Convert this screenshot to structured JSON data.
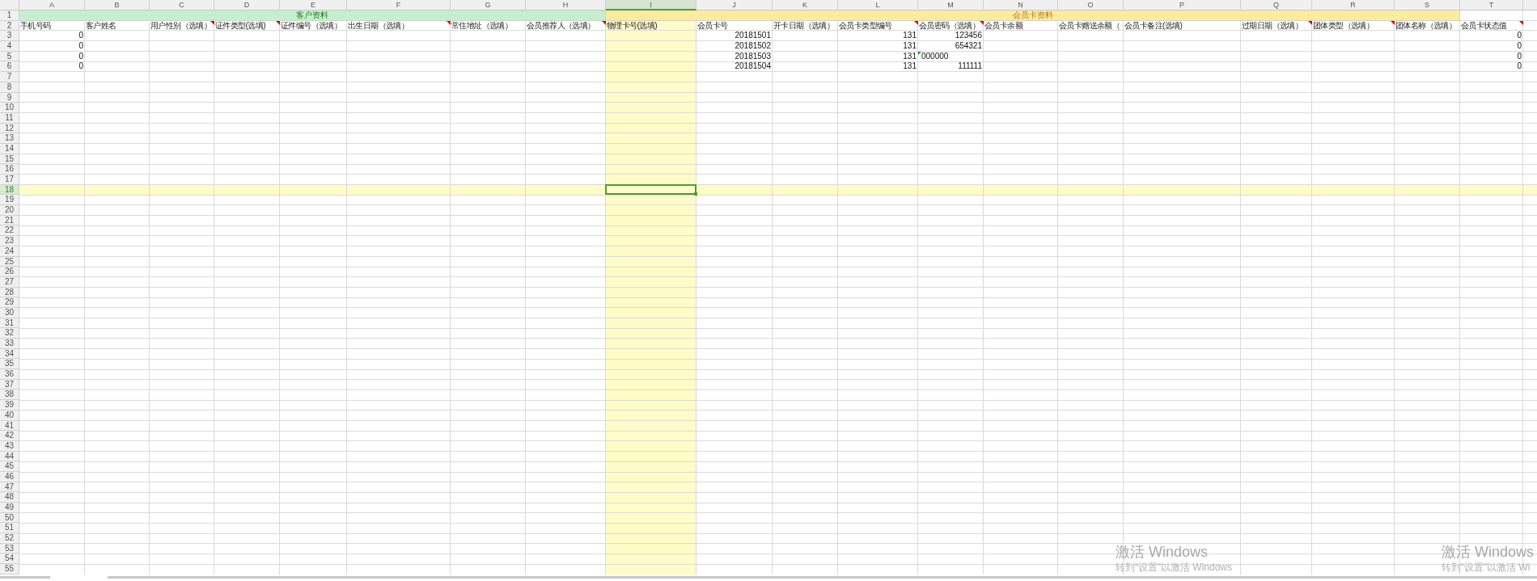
{
  "columns": [
    {
      "label": "A",
      "selected": false
    },
    {
      "label": "B",
      "selected": false
    },
    {
      "label": "C",
      "selected": false
    },
    {
      "label": "D",
      "selected": false
    },
    {
      "label": "E",
      "selected": false
    },
    {
      "label": "F",
      "selected": false
    },
    {
      "label": "G",
      "selected": false
    },
    {
      "label": "H",
      "selected": false
    },
    {
      "label": "I",
      "selected": true
    },
    {
      "label": "J",
      "selected": false
    },
    {
      "label": "K",
      "selected": false
    },
    {
      "label": "L",
      "selected": false
    },
    {
      "label": "M",
      "selected": false
    },
    {
      "label": "N",
      "selected": false
    },
    {
      "label": "O",
      "selected": false
    },
    {
      "label": "P",
      "selected": false
    },
    {
      "label": "Q",
      "selected": false
    },
    {
      "label": "R",
      "selected": false
    },
    {
      "label": "S",
      "selected": false
    },
    {
      "label": "T",
      "selected": false
    }
  ],
  "groups": [
    {
      "label": "客户资料",
      "kind": "customer",
      "color": "#c6efce"
    },
    {
      "label": "会员卡资料",
      "kind": "card",
      "color": "#ffeb9c"
    }
  ],
  "fields": [
    {
      "label": "手机号码",
      "comment": false
    },
    {
      "label": "客户姓名",
      "comment": false
    },
    {
      "label": "用户性别（选填）",
      "comment": true
    },
    {
      "label": "证件类型(选填)",
      "comment": true
    },
    {
      "label": "证件编号（选填）",
      "comment": false
    },
    {
      "label": "出生日期（选填）",
      "comment": true
    },
    {
      "label": "常住地址（选填）",
      "comment": false
    },
    {
      "label": "会员推荐人（选填）",
      "comment": true
    },
    {
      "label": "物理卡号(选填)",
      "comment": false
    },
    {
      "label": "会员卡号",
      "comment": false
    },
    {
      "label": "开卡日期（选填）",
      "comment": false
    },
    {
      "label": "会员卡类型编号",
      "comment": true
    },
    {
      "label": "会员密码（选填）",
      "comment": true
    },
    {
      "label": "会员卡余额",
      "comment": false
    },
    {
      "label": "会员卡赠送余额（",
      "comment": false
    },
    {
      "label": "会员卡备注(选填)",
      "comment": false
    },
    {
      "label": "过期日期（选填）",
      "comment": true
    },
    {
      "label": "团体类型（选填）",
      "comment": true
    },
    {
      "label": "团体名称（选填）",
      "comment": false
    },
    {
      "label": "会员卡状态值",
      "comment": true
    }
  ],
  "rows": [
    {
      "label": "1",
      "selected": false
    },
    {
      "label": "2",
      "selected": false
    },
    {
      "label": "3",
      "selected": false,
      "cells": [
        {
          "value": "0",
          "kind": "number"
        },
        null,
        null,
        null,
        null,
        null,
        null,
        null,
        null,
        {
          "value": "20181501",
          "kind": "number"
        },
        null,
        {
          "value": "131",
          "kind": "number"
        },
        {
          "value": "123456",
          "kind": "number"
        },
        null,
        null,
        null,
        null,
        null,
        null,
        {
          "value": "0",
          "kind": "number"
        }
      ]
    },
    {
      "label": "4",
      "selected": false,
      "cells": [
        {
          "value": "0",
          "kind": "number"
        },
        null,
        null,
        null,
        null,
        null,
        null,
        null,
        null,
        {
          "value": "20181502",
          "kind": "number"
        },
        null,
        {
          "value": "131",
          "kind": "number"
        },
        {
          "value": "654321",
          "kind": "number"
        },
        null,
        null,
        null,
        null,
        null,
        null,
        {
          "value": "0",
          "kind": "number"
        }
      ]
    },
    {
      "label": "5",
      "selected": false,
      "cells": [
        {
          "value": "0",
          "kind": "number"
        },
        null,
        null,
        null,
        null,
        null,
        null,
        null,
        null,
        {
          "value": "20181503",
          "kind": "number"
        },
        null,
        {
          "value": "131",
          "kind": "number"
        },
        {
          "value": "000000",
          "kind": "text"
        },
        null,
        null,
        null,
        null,
        null,
        null,
        {
          "value": "0",
          "kind": "number"
        }
      ]
    },
    {
      "label": "6",
      "selected": false,
      "cells": [
        {
          "value": "0",
          "kind": "number"
        },
        null,
        null,
        null,
        null,
        null,
        null,
        null,
        null,
        {
          "value": "20181504",
          "kind": "number"
        },
        null,
        {
          "value": "131",
          "kind": "number"
        },
        {
          "value": "111111",
          "kind": "number"
        },
        null,
        null,
        null,
        null,
        null,
        null,
        {
          "value": "0",
          "kind": "number"
        }
      ]
    },
    {
      "label": "7",
      "selected": false
    },
    {
      "label": "8",
      "selected": false
    },
    {
      "label": "9",
      "selected": false
    },
    {
      "label": "10",
      "selected": false
    },
    {
      "label": "11",
      "selected": false
    },
    {
      "label": "12",
      "selected": false
    },
    {
      "label": "13",
      "selected": false
    },
    {
      "label": "14",
      "selected": false
    },
    {
      "label": "15",
      "selected": false
    },
    {
      "label": "16",
      "selected": false
    },
    {
      "label": "17",
      "selected": false
    },
    {
      "label": "18",
      "selected": true
    },
    {
      "label": "19",
      "selected": false
    },
    {
      "label": "20",
      "selected": false
    },
    {
      "label": "21",
      "selected": false
    },
    {
      "label": "22",
      "selected": false
    },
    {
      "label": "23",
      "selected": false
    },
    {
      "label": "24",
      "selected": false
    },
    {
      "label": "25",
      "selected": false
    },
    {
      "label": "26",
      "selected": false
    },
    {
      "label": "27",
      "selected": false
    },
    {
      "label": "28",
      "selected": false
    },
    {
      "label": "29",
      "selected": false
    },
    {
      "label": "30",
      "selected": false
    },
    {
      "label": "31",
      "selected": false
    },
    {
      "label": "32",
      "selected": false
    },
    {
      "label": "33",
      "selected": false
    },
    {
      "label": "34",
      "selected": false
    },
    {
      "label": "35",
      "selected": false
    },
    {
      "label": "36",
      "selected": false
    },
    {
      "label": "37",
      "selected": false
    },
    {
      "label": "38",
      "selected": false
    },
    {
      "label": "39",
      "selected": false
    },
    {
      "label": "40",
      "selected": false
    },
    {
      "label": "41",
      "selected": false
    },
    {
      "label": "42",
      "selected": false
    },
    {
      "label": "43",
      "selected": false
    },
    {
      "label": "44",
      "selected": false
    },
    {
      "label": "45",
      "selected": false
    },
    {
      "label": "46",
      "selected": false
    },
    {
      "label": "47",
      "selected": false
    },
    {
      "label": "48",
      "selected": false
    },
    {
      "label": "49",
      "selected": false
    },
    {
      "label": "50",
      "selected": false
    },
    {
      "label": "51",
      "selected": false
    },
    {
      "label": "52",
      "selected": false
    },
    {
      "label": "53",
      "selected": false
    },
    {
      "label": "54",
      "selected": false
    },
    {
      "label": "55",
      "selected": false
    }
  ],
  "activation_notices": [
    {
      "title": "激活 Windows",
      "subtitle": "转到“设置”以激活 Windows"
    },
    {
      "title": "激活 Windows",
      "subtitle": "转到“设置”以激活 Wi"
    }
  ]
}
